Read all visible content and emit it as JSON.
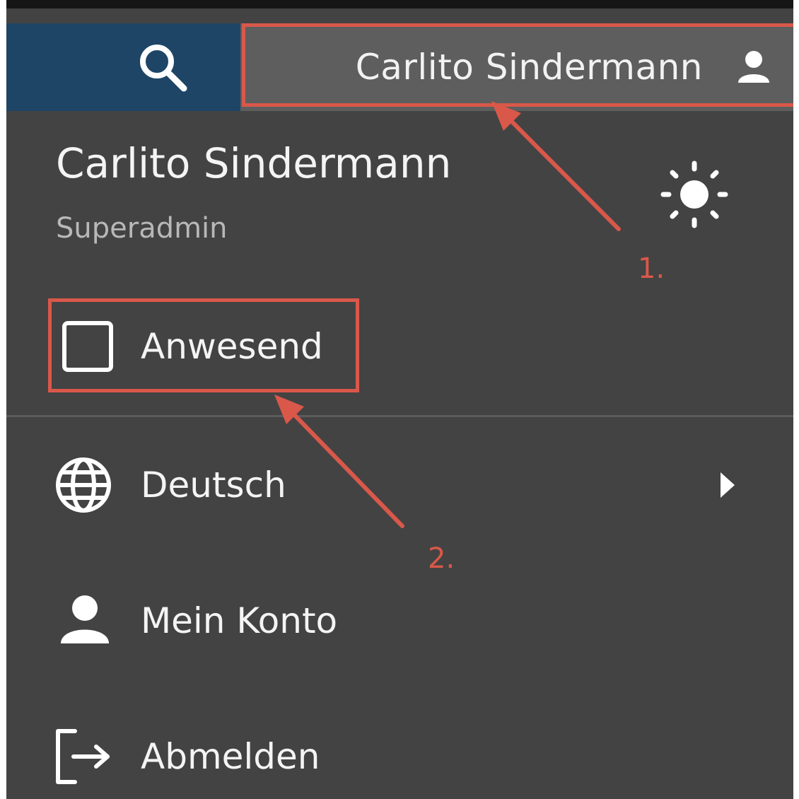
{
  "header": {
    "user_name": "Carlito Sindermann"
  },
  "menu": {
    "title": "Carlito Sindermann",
    "role": "Superadmin",
    "presence_label": "Anwesend",
    "language_label": "Deutsch",
    "account_label": "Mein Konto",
    "logout_label": "Abmelden"
  },
  "annotations": {
    "step1": "1.",
    "step2": "2."
  },
  "colors": {
    "panel_bg": "#434343",
    "search_bg": "#1e4565",
    "user_bg": "#5e5e5e",
    "annotation_red": "#d9584a"
  },
  "icons": [
    "search-icon",
    "person-icon",
    "sun-icon",
    "checkbox-icon",
    "globe-icon",
    "chevron-right-icon",
    "logout-icon"
  ]
}
